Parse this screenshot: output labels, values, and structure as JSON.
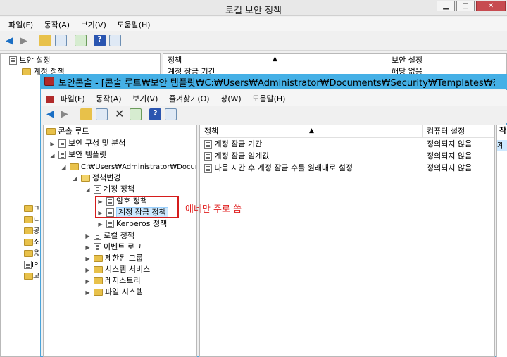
{
  "bg_window": {
    "title": "로컬 보안 정책",
    "menu": [
      "파일(F)",
      "동작(A)",
      "보기(V)",
      "도움말(H)"
    ],
    "left_root": "보안 설정",
    "left_child": "계정 정책",
    "col_policy": "정책",
    "col_setting": "보안 설정",
    "row1_policy": "계정 잠금 기간",
    "row1_setting": "해당 없음",
    "left_partial": [
      "ㄱ",
      "ㄴ",
      "공",
      "소",
      "응",
      "IP",
      "고"
    ]
  },
  "front_window": {
    "title": "보안콘솔 - [콘솔 루트₩보안 템플릿₩C:₩Users₩Administrator₩Documents₩Security₩Templates₩정...",
    "menu": [
      "파일(F)",
      "동작(A)",
      "보기(V)",
      "즐겨찾기(O)",
      "창(W)",
      "도움말(H)"
    ],
    "tree": {
      "root": "콘솔 루트",
      "security_config": "보안 구성 및 분석",
      "security_templates": "보안 템플릿",
      "path": "C:₩Users₩Administrator₩Documents",
      "policy_change": "정책변경",
      "account_policy": "계정 정책",
      "password_policy": "암호 정책",
      "lockout_policy": "계정 잠금 정책",
      "kerberos": "Kerberos 정책",
      "local_policy": "로컬 정책",
      "event_log": "이벤트 로그",
      "restricted_groups": "제한된 그룹",
      "system_services": "시스템 서비스",
      "registry": "레지스트리",
      "file_system": "파일 시스템"
    },
    "list": {
      "col_policy": "정책",
      "col_computer": "컴퓨터 설정",
      "rows": [
        {
          "policy": "계정 잠금 기간",
          "setting": "정의되지 않음"
        },
        {
          "policy": "계정 잠금 임계값",
          "setting": "정의되지 않음"
        },
        {
          "policy": "다음 시간 후 계정 잠금 수를 원래대로 설정",
          "setting": "정의되지 않음"
        }
      ]
    },
    "action_pane": {
      "header": "작",
      "item": "계"
    }
  },
  "annotation": "애네만 주로 씀"
}
